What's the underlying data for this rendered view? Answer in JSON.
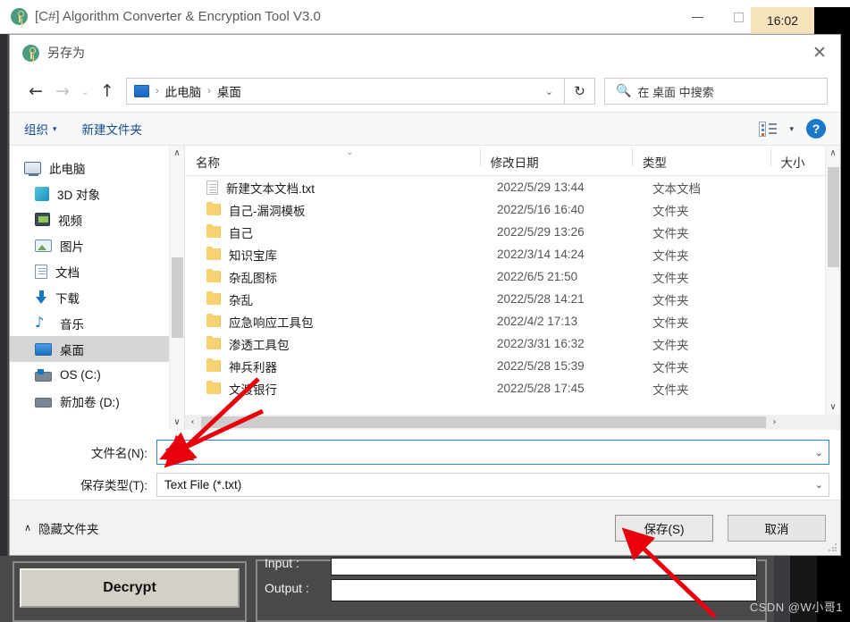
{
  "background_app": {
    "title": "[C#] Algorithm Converter & Encryption Tool V3.0",
    "icon": "key-icon",
    "window_controls": {
      "minimize": "–",
      "maximize": "□",
      "close": "✕"
    },
    "clock": "16:02",
    "decrypt_button": "Decrypt",
    "input_label": "Input :",
    "output_label": "Output :",
    "watermark": "CSDN @W小哥1"
  },
  "dialog": {
    "title": "另存为",
    "icon": "key-icon",
    "close": "✕",
    "nav": {
      "back": "←",
      "forward": "→",
      "recent_caret": "⌄",
      "up": "↑",
      "refresh": "↻",
      "address_caret": "⌄",
      "breadcrumbs": [
        "此电脑",
        "桌面"
      ],
      "separator": "›"
    },
    "search": {
      "placeholder": "在 桌面 中搜索",
      "icon": "search-icon"
    },
    "commandbar": {
      "organize": "组织",
      "organize_caret": "▾",
      "new_folder": "新建文件夹",
      "view_caret": "▾",
      "help": "?"
    },
    "sidebar": {
      "items": [
        {
          "label": "此电脑",
          "icon": "computer-icon",
          "selected": false,
          "root": true
        },
        {
          "label": "3D 对象",
          "icon": "3d-objects-icon",
          "selected": false
        },
        {
          "label": "视频",
          "icon": "videos-icon",
          "selected": false
        },
        {
          "label": "图片",
          "icon": "pictures-icon",
          "selected": false
        },
        {
          "label": "文档",
          "icon": "documents-icon",
          "selected": false
        },
        {
          "label": "下载",
          "icon": "downloads-icon",
          "selected": false
        },
        {
          "label": "音乐",
          "icon": "music-icon",
          "selected": false
        },
        {
          "label": "桌面",
          "icon": "desktop-icon",
          "selected": true
        },
        {
          "label": "OS (C:)",
          "icon": "os-drive-icon",
          "selected": false
        },
        {
          "label": "新加卷 (D:)",
          "icon": "drive-icon",
          "selected": false
        }
      ],
      "scroll_up": "∧",
      "scroll_down": "∨"
    },
    "filelist": {
      "columns": [
        "名称",
        "修改日期",
        "类型",
        "大小"
      ],
      "sort_caret": "⌄",
      "rows": [
        {
          "name": "新建文本文档.txt",
          "date": "2022/5/29 13:44",
          "type": "文本文档",
          "size": "",
          "icon": "text-file-icon"
        },
        {
          "name": "自己-漏洞模板",
          "date": "2022/5/16 16:40",
          "type": "文件夹",
          "size": "",
          "icon": "folder-icon"
        },
        {
          "name": "自己",
          "date": "2022/5/29 13:26",
          "type": "文件夹",
          "size": "",
          "icon": "folder-icon"
        },
        {
          "name": "知识宝库",
          "date": "2022/3/14 14:24",
          "type": "文件夹",
          "size": "",
          "icon": "folder-icon"
        },
        {
          "name": "杂乱图标",
          "date": "2022/6/5 21:50",
          "type": "文件夹",
          "size": "",
          "icon": "folder-icon"
        },
        {
          "name": "杂乱",
          "date": "2022/5/28 14:21",
          "type": "文件夹",
          "size": "",
          "icon": "folder-icon"
        },
        {
          "name": "应急响应工具包",
          "date": "2022/4/2 17:13",
          "type": "文件夹",
          "size": "",
          "icon": "folder-icon"
        },
        {
          "name": "渗透工具包",
          "date": "2022/3/31 16:32",
          "type": "文件夹",
          "size": "",
          "icon": "folder-icon"
        },
        {
          "name": "神兵利器",
          "date": "2022/5/28 15:39",
          "type": "文件夹",
          "size": "",
          "icon": "folder-icon"
        },
        {
          "name": "文渡银行",
          "date": "2022/5/28 17:45",
          "type": "文件夹",
          "size": "",
          "icon": "folder-icon"
        }
      ],
      "hscroll_left": "‹",
      "hscroll_right": "›"
    },
    "form": {
      "filename_label": "文件名(N):",
      "filename_value": "1",
      "filetype_label": "保存类型(T):",
      "filetype_value": "Text File (*.txt)",
      "caret": "⌄"
    },
    "footer": {
      "hide_folders": "隐藏文件夹",
      "hide_caret": "∧",
      "save": "保存(S)",
      "cancel": "取消"
    }
  },
  "annotations": {
    "arrow_color": "#e8000d"
  }
}
